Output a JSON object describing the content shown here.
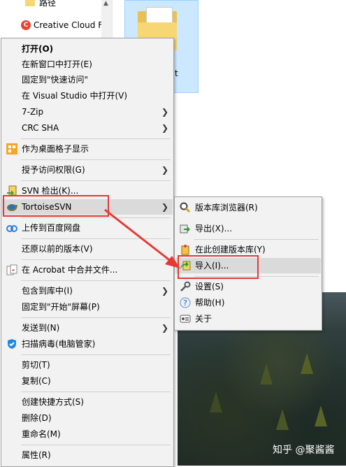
{
  "nav": {
    "items": [
      {
        "label": "路径",
        "icon": "folder-icon"
      },
      {
        "label": "Creative Cloud F",
        "icon": "creative-cloud-icon"
      }
    ]
  },
  "tile": {
    "label": "t"
  },
  "context_menu": {
    "items": [
      {
        "label": "打开(O)",
        "bold": true
      },
      {
        "label": "在新窗口中打开(E)"
      },
      {
        "label": "固定到\"快速访问\""
      },
      {
        "label": "在 Visual Studio 中打开(V)"
      },
      {
        "label": "7-Zip",
        "submenu": true
      },
      {
        "label": "CRC SHA",
        "submenu": true
      },
      {
        "label": "作为桌面格子显示",
        "icon": "desktop-grid-icon"
      },
      {
        "label": "授予访问权限(G)",
        "submenu": true
      },
      {
        "label": "SVN 检出(K)...",
        "icon": "svn-checkout-icon"
      },
      {
        "label": "TortoiseSVN",
        "icon": "tortoisesvn-icon",
        "submenu": true
      },
      {
        "label": "上传到百度网盘",
        "icon": "baidu-cloud-icon"
      },
      {
        "label": "还原以前的版本(V)"
      },
      {
        "label": "在 Acrobat 中合并文件...",
        "icon": "acrobat-icon"
      },
      {
        "label": "包含到库中(I)",
        "submenu": true
      },
      {
        "label": "固定到\"开始\"屏幕(P)"
      },
      {
        "label": "发送到(N)",
        "submenu": true
      },
      {
        "label": "扫描病毒(电脑管家)",
        "icon": "shield-icon"
      },
      {
        "label": "剪切(T)"
      },
      {
        "label": "复制(C)"
      },
      {
        "label": "创建快捷方式(S)"
      },
      {
        "label": "删除(D)"
      },
      {
        "label": "重命名(M)"
      },
      {
        "label": "属性(R)"
      }
    ]
  },
  "submenu": {
    "items": [
      {
        "label": "版本库浏览器(R)",
        "icon": "repo-browser-icon"
      },
      {
        "label": "导出(X)...",
        "icon": "export-icon"
      },
      {
        "label": "在此创建版本库(Y)",
        "icon": "create-repo-icon"
      },
      {
        "label": "导入(I)...",
        "icon": "import-icon"
      },
      {
        "label": "设置(S)",
        "icon": "settings-icon"
      },
      {
        "label": "帮助(H)",
        "icon": "help-icon"
      },
      {
        "label": "关于",
        "icon": "about-icon"
      }
    ]
  },
  "watermark": "知乎 @聚酱酱",
  "colors": {
    "annotation": "#e53935",
    "highlight": "#dadada",
    "menu_bg": "#f2f2f2"
  }
}
